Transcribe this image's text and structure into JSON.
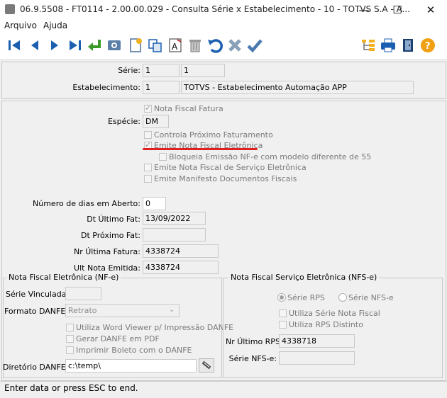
{
  "window": {
    "title": "06.9.5508 - FT0114 - 2.00.00.029 - Consulta Série x Estabelecimento - 10 - TOTVS S.A - A...",
    "minimize": "—",
    "maximize": "☐",
    "close": "✕"
  },
  "menu": {
    "file": "Arquivo",
    "help": "Ajuda"
  },
  "toolbar": {
    "icons": [
      "first",
      "previous",
      "next",
      "last",
      "goto",
      "search",
      "new",
      "copy",
      "edit",
      "delete",
      "undo",
      "cancel",
      "save",
      "tree",
      "print",
      "exit",
      "help"
    ]
  },
  "header": {
    "serie_label": "Série:",
    "serie_value": "1",
    "serie_desc": "1",
    "estab_label": "Estabelecimento:",
    "estab_value": "1",
    "estab_desc": "TOTVS - Estabelecimento Automação APP"
  },
  "options": {
    "nf_fatura": "Nota Fiscal Fatura",
    "especie_label": "Espécie:",
    "especie_value": "DM",
    "controla_proximo": "Controla Próximo Faturamento",
    "emite_nfe": "Emite Nota Fiscal Eletrônica",
    "bloqueia_emissao": "Bloqueia Emissão NF-e com modelo diferente de 55",
    "emite_nfse": "Emite Nota Fiscal de Serviço Eletrônica",
    "emite_manifesto": "Emite Manifesto Documentos Fiscais",
    "dias_label": "Número de dias em Aberto:",
    "dias_value": "0",
    "dt_ultimo_label": "Dt Último Fat:",
    "dt_ultimo_value": "13/09/2022",
    "dt_proximo_label": "Dt Próximo Fat:",
    "dt_proximo_value": "",
    "nr_ultima_label": "Nr Última Fatura:",
    "nr_ultima_value": "4338724",
    "ult_nota_label": "Ult Nota Emitida:",
    "ult_nota_value": "4338724"
  },
  "nfe": {
    "legend": "Nota Fiscal Eletrônica (NF-e)",
    "serie_vinc_label": "Série Vinculada:",
    "serie_vinc_value": "",
    "formato_label": "Formato DANFE:",
    "formato_value": "Retrato",
    "word_viewer": "Utiliza Word Viewer p/ Impressão DANFE",
    "gerar_pdf": "Gerar DANFE em PDF",
    "imprimir_boleto": "Imprimir Boleto com o DANFE",
    "diretorio_label": "Diretório DANFE:",
    "diretorio_value": "c:\\temp\\"
  },
  "nfse": {
    "legend": "Nota Fiscal Serviço Eletrônica (NFS-e)",
    "serie_rps": "Série RPS",
    "serie_nfse": "Série NFS-e",
    "utiliza_serie_nf": "Utiliza Série Nota Fiscal",
    "utiliza_rps": "Utiliza RPS Distinto",
    "nr_ultimo_rps_label": "Nr Último RPS:",
    "nr_ultimo_rps_value": "4338718",
    "serie_nfse_label": "Série NFS-e:",
    "serie_nfse_value": ""
  },
  "status": "Enter data or press ESC to end.",
  "colors": {
    "underline": "#e02020",
    "toolbar_blue": "#1b5fb0"
  }
}
